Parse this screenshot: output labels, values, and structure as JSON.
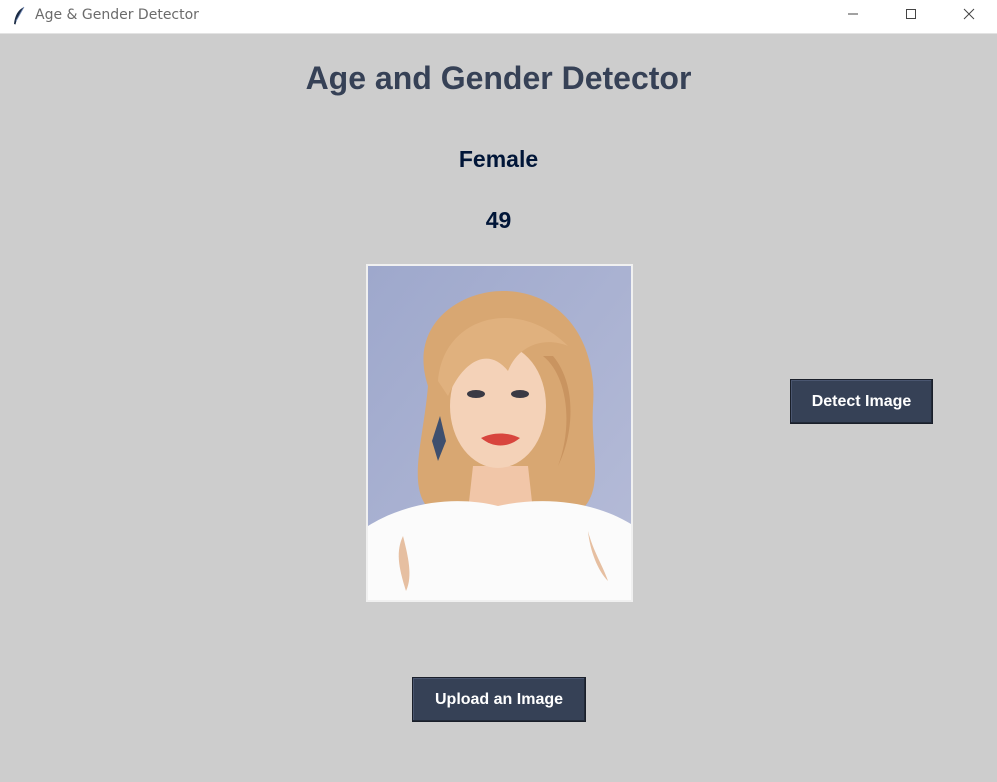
{
  "window": {
    "title": "Age & Gender Detector",
    "app_icon": "feather-icon",
    "controls": [
      "minimize-icon",
      "maximize-icon",
      "close-icon"
    ]
  },
  "main": {
    "heading": "Age and Gender Detector",
    "gender_result": "Female",
    "age_result": "49"
  },
  "buttons": {
    "detect_label": "Detect Image",
    "upload_label": "Upload an Image"
  },
  "colors": {
    "background": "#cdcdcd",
    "heading": "#364156",
    "result_text": "#011638",
    "button_bg": "#364156",
    "button_text": "#ffffff"
  }
}
